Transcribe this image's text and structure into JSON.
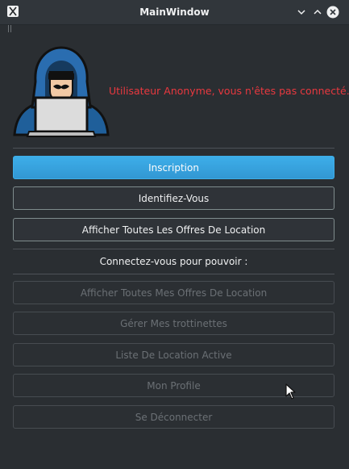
{
  "window": {
    "title": "MainWindow",
    "controls": [
      "minimize-icon",
      "maximize-icon",
      "close-icon"
    ]
  },
  "header": {
    "anon_message": "Utilisateur Anonyme, vous n'êtes pas connecté.",
    "avatar_icon": "hooded-hacker-icon"
  },
  "buttons": {
    "inscription": "Inscription",
    "identify": "Identifiez-Vous",
    "show_all_offers": "Afficher Toutes Les Offres De Location"
  },
  "connect_prompt": "Connectez-vous pour pouvoir :",
  "disabled_buttons": {
    "my_offers": "Afficher Toutes Mes Offres De Location",
    "manage_scooters": "Gérer Mes trottinettes",
    "active_rentals": "Liste De Location Active",
    "profile": "Mon Profile",
    "logout": "Se Déconnecter"
  },
  "colors": {
    "accent": "#3daee9",
    "warning_text": "#e9383f",
    "window_bg": "#2a2e32",
    "titlebar_bg": "#31363b",
    "close_button": "#eff0f1"
  }
}
